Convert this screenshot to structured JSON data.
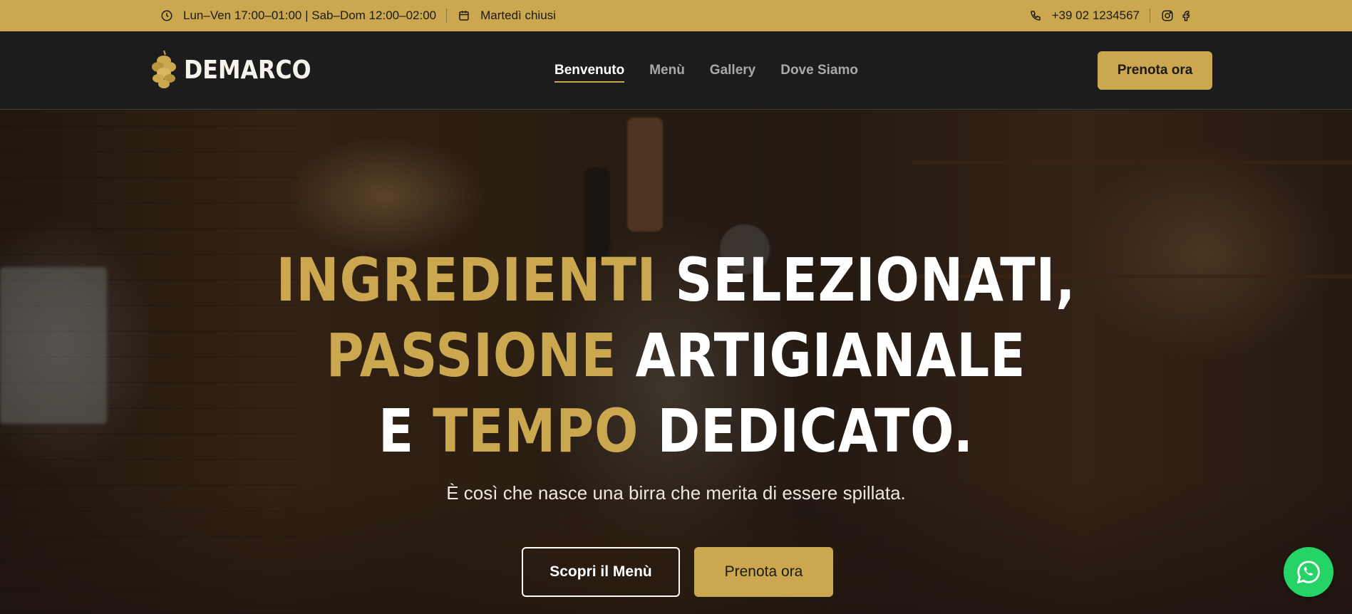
{
  "topbar": {
    "hours": "Lun–Ven 17:00–01:00 | Sab–Dom 12:00–02:00",
    "closed": "Martedì chiusi",
    "phone": "+39 02 1234567",
    "icons": [
      "clock-icon",
      "calendar-icon",
      "phone-icon",
      "instagram-icon",
      "facebook-icon"
    ]
  },
  "header": {
    "logo_text": "DEMARCO",
    "nav": [
      {
        "label": "Benvenuto",
        "active": true
      },
      {
        "label": "Menù",
        "active": false
      },
      {
        "label": "Gallery",
        "active": false
      },
      {
        "label": "Dove Siamo",
        "active": false
      }
    ],
    "cta_label": "Prenota ora"
  },
  "hero": {
    "line1_gold": "INGREDIENTI",
    "line1_white": "SELEZIONATI,",
    "line2_gold": "PASSIONE",
    "line2_white": "ARTIGIANALE",
    "line3_white_a": "E",
    "line3_gold": "TEMPO",
    "line3_white_b": "DEDICATO.",
    "subtitle": "È così che nasce una birra che merita di essere spillata.",
    "btn_menu": "Scopri il Menù",
    "btn_book": "Prenota ora"
  },
  "colors": {
    "accent": "#cba850",
    "header_bg": "#1c1c1c",
    "whatsapp": "#25d366"
  }
}
